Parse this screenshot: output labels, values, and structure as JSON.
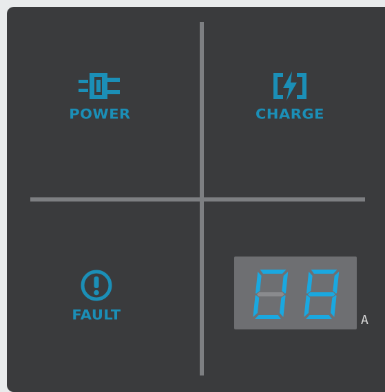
{
  "indicators": {
    "power": {
      "label": "POWER",
      "icon": "plug-icon",
      "color": "#1b8fb7"
    },
    "charge": {
      "label": "CHARGE",
      "icon": "battery-charging-icon",
      "color": "#1b8fb7"
    },
    "fault": {
      "label": "FAULT",
      "icon": "exclamation-circle-icon",
      "color": "#1b8fb7"
    }
  },
  "display": {
    "digits": [
      "0",
      "8"
    ],
    "unit": "A",
    "segment_on_color": "#1aa8e0",
    "segment_off_color": "#8a8b8e"
  }
}
